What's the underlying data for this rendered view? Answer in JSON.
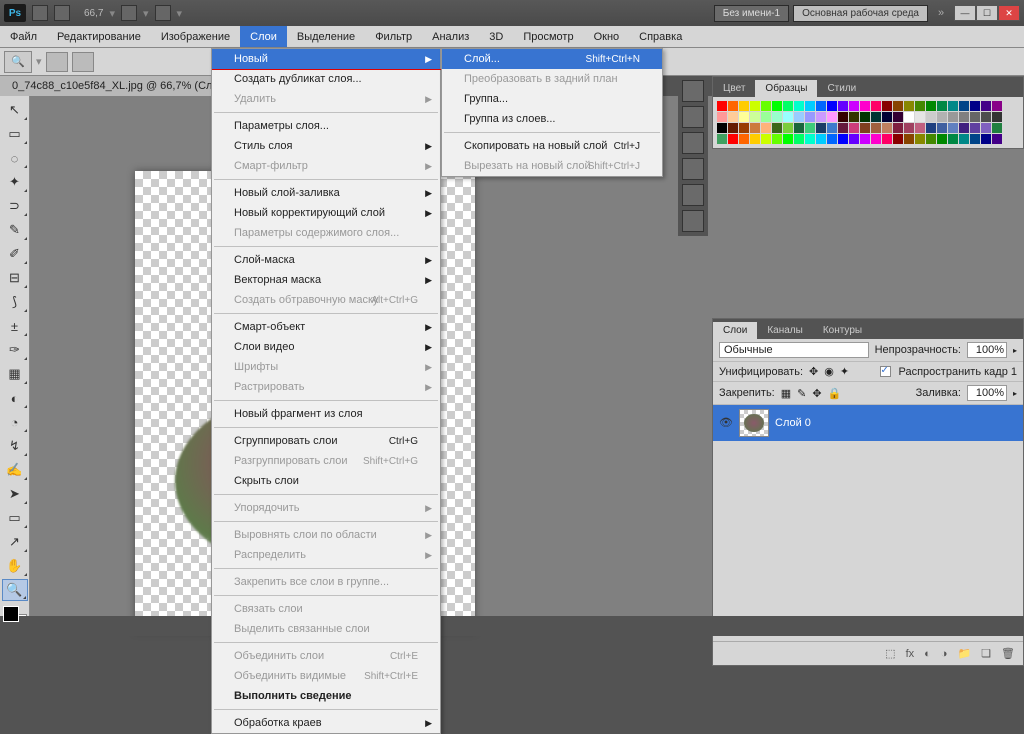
{
  "title": {
    "doc": "Без имени-1",
    "workspace": "Основная рабочая среда",
    "zoom_top": "66,7"
  },
  "menubar": [
    "Файл",
    "Редактирование",
    "Изображение",
    "Слои",
    "Выделение",
    "Фильтр",
    "Анализ",
    "3D",
    "Просмотр",
    "Окно",
    "Справка"
  ],
  "active_menu_index": 3,
  "doc_tab": "0_74c88_c10e5f84_XL.jpg @ 66,7% (Сло",
  "dropdown": [
    {
      "t": "item",
      "label": "Новый",
      "hl": true,
      "arrow": true
    },
    {
      "t": "item",
      "label": "Создать дубликат слоя..."
    },
    {
      "t": "item",
      "label": "Удалить",
      "arrow": true,
      "disabled": true
    },
    {
      "t": "sep"
    },
    {
      "t": "item",
      "label": "Параметры слоя..."
    },
    {
      "t": "item",
      "label": "Стиль слоя",
      "arrow": true
    },
    {
      "t": "item",
      "label": "Смарт-фильтр",
      "arrow": true,
      "disabled": true
    },
    {
      "t": "sep"
    },
    {
      "t": "item",
      "label": "Новый слой-заливка",
      "arrow": true
    },
    {
      "t": "item",
      "label": "Новый корректирующий слой",
      "arrow": true
    },
    {
      "t": "item",
      "label": "Параметры содержимого слоя...",
      "disabled": true
    },
    {
      "t": "sep"
    },
    {
      "t": "item",
      "label": "Слой-маска",
      "arrow": true
    },
    {
      "t": "item",
      "label": "Векторная маска",
      "arrow": true
    },
    {
      "t": "item",
      "label": "Создать обтравочную маску",
      "sc": "Alt+Ctrl+G",
      "disabled": true
    },
    {
      "t": "sep"
    },
    {
      "t": "item",
      "label": "Смарт-объект",
      "arrow": true
    },
    {
      "t": "item",
      "label": "Слои видео",
      "arrow": true
    },
    {
      "t": "item",
      "label": "Шрифты",
      "arrow": true,
      "disabled": true
    },
    {
      "t": "item",
      "label": "Растрировать",
      "arrow": true,
      "disabled": true
    },
    {
      "t": "sep"
    },
    {
      "t": "item",
      "label": "Новый фрагмент из слоя"
    },
    {
      "t": "sep"
    },
    {
      "t": "item",
      "label": "Сгруппировать слои",
      "sc": "Ctrl+G"
    },
    {
      "t": "item",
      "label": "Разгруппировать слои",
      "sc": "Shift+Ctrl+G",
      "disabled": true
    },
    {
      "t": "item",
      "label": "Скрыть слои"
    },
    {
      "t": "sep"
    },
    {
      "t": "item",
      "label": "Упорядочить",
      "arrow": true,
      "disabled": true
    },
    {
      "t": "sep"
    },
    {
      "t": "item",
      "label": "Выровнять слои по области",
      "arrow": true,
      "disabled": true
    },
    {
      "t": "item",
      "label": "Распределить",
      "arrow": true,
      "disabled": true
    },
    {
      "t": "sep"
    },
    {
      "t": "item",
      "label": "Закрепить все слои в группе...",
      "disabled": true
    },
    {
      "t": "sep"
    },
    {
      "t": "item",
      "label": "Связать слои",
      "disabled": true
    },
    {
      "t": "item",
      "label": "Выделить связанные слои",
      "disabled": true
    },
    {
      "t": "sep"
    },
    {
      "t": "item",
      "label": "Объединить слои",
      "sc": "Ctrl+E",
      "disabled": true
    },
    {
      "t": "item",
      "label": "Объединить видимые",
      "sc": "Shift+Ctrl+E",
      "disabled": true
    },
    {
      "t": "item",
      "label": "Выполнить сведение",
      "bold": true
    },
    {
      "t": "sep"
    },
    {
      "t": "item",
      "label": "Обработка краев",
      "arrow": true
    }
  ],
  "submenu": [
    {
      "t": "item",
      "label": "Слой...",
      "hl": true,
      "sc": "Shift+Ctrl+N"
    },
    {
      "t": "item",
      "label": "Преобразовать в задний план",
      "disabled": true
    },
    {
      "t": "item",
      "label": "Группа..."
    },
    {
      "t": "item",
      "label": "Группа из слоев..."
    },
    {
      "t": "sep"
    },
    {
      "t": "item",
      "label": "Скопировать на новый слой",
      "sc": "Ctrl+J"
    },
    {
      "t": "item",
      "label": "Вырезать на новый слой",
      "sc": "Shift+Ctrl+J",
      "disabled": true
    }
  ],
  "panels": {
    "color_tabs": [
      "Цвет",
      "Образцы",
      "Стили"
    ],
    "layers_tabs": [
      "Слои",
      "Каналы",
      "Контуры"
    ],
    "blend": "Обычные",
    "opacity_label": "Непрозрачность:",
    "opacity": "100%",
    "unify": "Унифицировать:",
    "propagate": "Распространить кадр 1",
    "lock": "Закрепить:",
    "fill_label": "Заливка:",
    "fill": "100%",
    "layer0": "Слой 0"
  },
  "tools": [
    "↖",
    "▭",
    "◌",
    "✦",
    "⊃",
    "✎",
    "✐",
    "⊟",
    "⟆",
    "±",
    "✑",
    "▦",
    "◐",
    "◔",
    "↯",
    "✍",
    "➤",
    "▭",
    "↗",
    "✋",
    "🔍"
  ],
  "swatch_colors": [
    "#ff0000",
    "#ff6600",
    "#ffcc00",
    "#ccff00",
    "#66ff00",
    "#00ff00",
    "#00ff66",
    "#00ffcc",
    "#00ccff",
    "#0066ff",
    "#0000ff",
    "#6600ff",
    "#cc00ff",
    "#ff00cc",
    "#ff0066",
    "#880000",
    "#884400",
    "#888800",
    "#448800",
    "#008800",
    "#008844",
    "#008888",
    "#004488",
    "#000088",
    "#440088",
    "#880088",
    "#ff9999",
    "#ffcc99",
    "#ffff99",
    "#ccff99",
    "#99ff99",
    "#99ffcc",
    "#99ffff",
    "#99ccff",
    "#9999ff",
    "#cc99ff",
    "#ff99ff",
    "#330000",
    "#333300",
    "#003300",
    "#003333",
    "#000033",
    "#330033",
    "#ffffff",
    "#e5e5e5",
    "#cccccc",
    "#b2b2b2",
    "#999999",
    "#808080",
    "#666666",
    "#4d4d4d",
    "#333333",
    "#000000",
    "#661a00",
    "#993d00",
    "#cc7a3d",
    "#ffb27a",
    "#3d661a",
    "#7acc3d",
    "#1a663d",
    "#3dcc7a",
    "#1a3d66",
    "#3d7acc",
    "#661a3d",
    "#cc3d7a",
    "#804020",
    "#a06040",
    "#c08060",
    "#802040",
    "#a04060",
    "#c06080",
    "#204080",
    "#4060a0",
    "#6080c0",
    "#402080",
    "#6040a0",
    "#8060c0",
    "#208040",
    "#40a060"
  ]
}
